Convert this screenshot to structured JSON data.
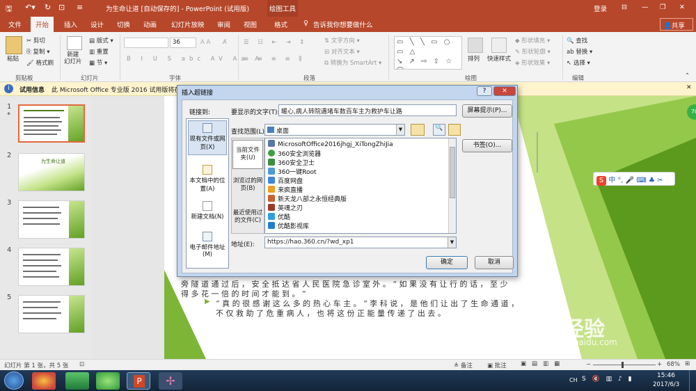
{
  "app": {
    "title": "为生命让道 [自动保存的] - PowerPoint (试用版)",
    "context_tab": "绘图工具",
    "login": "登录",
    "share": "共享"
  },
  "tabs": [
    "文件",
    "开始",
    "插入",
    "设计",
    "切换",
    "动画",
    "幻灯片放映",
    "审阅",
    "视图",
    "格式"
  ],
  "tell_me": "告诉我你想要做什么",
  "ribbon": {
    "clipboard": {
      "paste": "粘贴",
      "cut": "剪切",
      "copy": "复制",
      "painter": "格式刷",
      "group": "剪贴板"
    },
    "slides": {
      "new_slide": "新建\n幻灯片",
      "layout": "版式",
      "reset": "重置",
      "section": "节",
      "group": "幻灯片"
    },
    "font": {
      "font_name": "",
      "font_size": "36",
      "group": "字体"
    },
    "paragraph": {
      "text_direction": "文字方向",
      "align_text": "对齐文本",
      "smartart": "转换为 SmartArt",
      "group": "段落"
    },
    "drawing": {
      "arrange": "排列",
      "quick_styles": "快速样式",
      "fill": "形状填充",
      "outline": "形状轮廓",
      "effects": "形状效果",
      "group": "绘图"
    },
    "editing": {
      "find": "查找",
      "replace": "替换",
      "select": "选择",
      "group": "编辑"
    }
  },
  "infobar": {
    "label": "试用信息",
    "text": "此 Microsoft Office 专业版 2016 试用版将在"
  },
  "thumbnails": [
    {
      "n": "1",
      "star": "*"
    },
    {
      "n": "2",
      "title": "为生命让道"
    },
    {
      "n": "3"
    },
    {
      "n": "4"
    },
    {
      "n": "5"
    }
  ],
  "slide": {
    "line1": "旁 隧 道 通 过 后 ， 安 全 抵 达 省 人 民 医 院 急 诊 室 外 。 “ 如 果 没 有 让 行 的 话 ， 至 少",
    "line2": "得 多 花 一 倍 的 时 间 才 能 到 。 ”",
    "bullet1a": "“ 真 的 很 感 谢 这 么 多 的 热 心 车 主 。 ” 李 科 说 ， 是 他 们 让 出 了 生 命 通 道 ，",
    "bullet1b": "不 仅 救 助 了 危 重 病 人 ， 也 将 这 份 正 能 量 传 递 了 出 去 。"
  },
  "dialog": {
    "title": "插入超链接",
    "help": "?",
    "link_to_label": "链接到:",
    "display_text_label": "要显示的文字(T):",
    "display_text": "暖心,病人转院遇堵车数百车主为救护车让路",
    "screen_tip": "屏幕提示(P)...",
    "look_in_label": "查找范围(L):",
    "look_in": "桌面",
    "link_types": [
      "现有文件或网页(X)",
      "本文档中的位置(A)",
      "新建文档(N)",
      "电子邮件地址(M)"
    ],
    "sub_tabs": [
      "当前文件夹(U)",
      "浏览过的网页(B)",
      "最近使用过的文件(C)"
    ],
    "files": [
      "MicrosoftOffice2016jhgj_XiTongZhiJia",
      "360安全浏览器",
      "360安全卫士",
      "360一键Root",
      "百度网盘",
      "来疯直播",
      "新天龙八部之永恒经典版",
      "英魂之刃",
      "优酷",
      "优酷影视库"
    ],
    "bookmark": "书签(O)...",
    "address_label": "地址(E):",
    "address": "https://hao.360.cn/?wd_xp1",
    "ok": "确定",
    "cancel": "取消"
  },
  "ime": {
    "label": "中"
  },
  "status": {
    "slide": "幻灯片 第 1 张，共 5 张",
    "notes": "备注",
    "comments": "批注",
    "zoom": "68%"
  },
  "watermark": "Bai 经验",
  "watermark_url": "jingyan.baidu.com",
  "badge": "70",
  "taskbar": {
    "lang": "CH",
    "time": "15:46",
    "date": "2017/6/3"
  }
}
